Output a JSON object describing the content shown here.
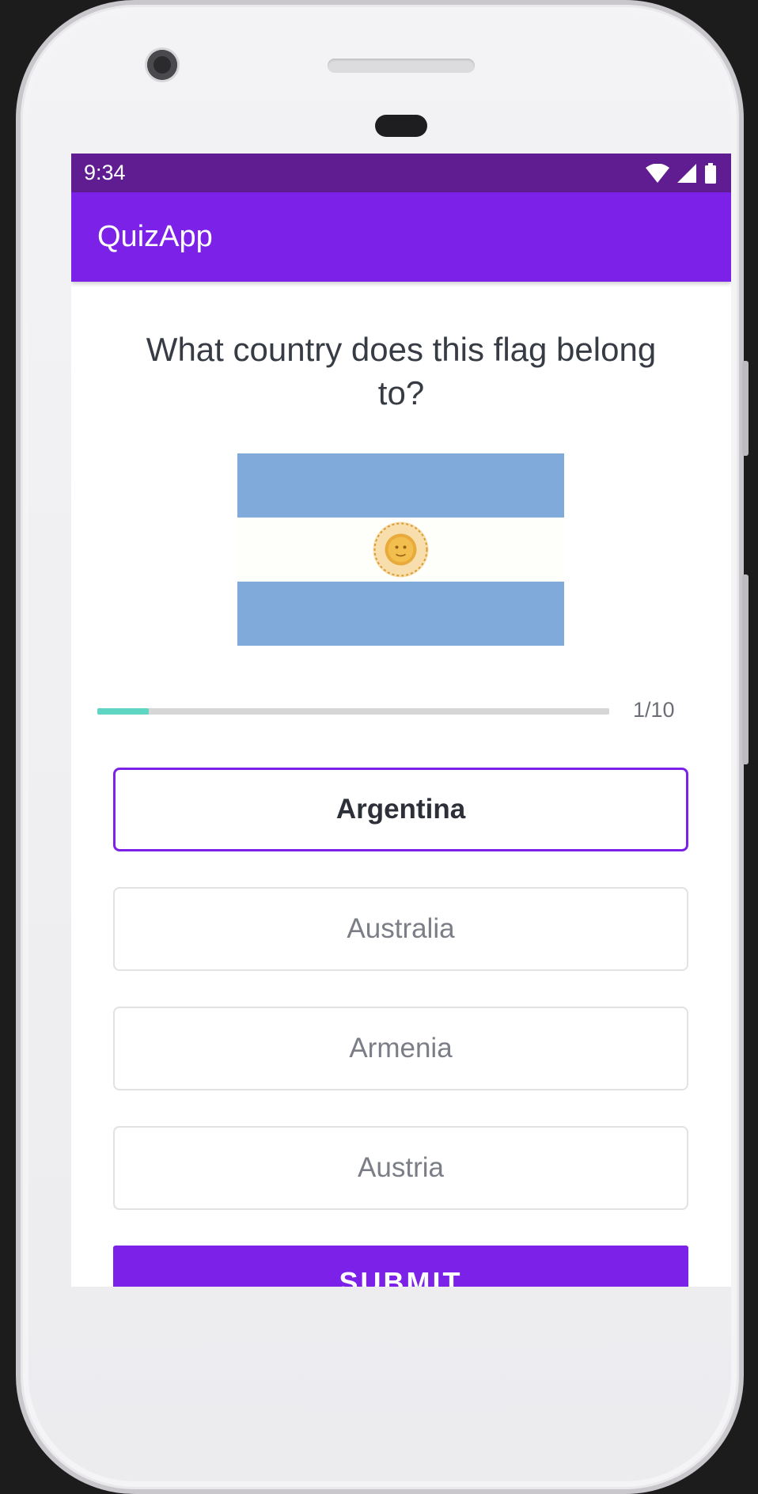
{
  "status_bar": {
    "time": "9:34"
  },
  "app_bar": {
    "title": "QuizApp"
  },
  "question": {
    "text": "What country does this flag belong to?"
  },
  "flag": {
    "icon": "argentina-flag",
    "colors": {
      "stripe": "#80aad9",
      "sun": "#e3a531"
    }
  },
  "progress": {
    "current": 1,
    "total": 10,
    "label": "1/10",
    "fraction": 0.1
  },
  "options": [
    {
      "label": "Argentina",
      "selected": true
    },
    {
      "label": "Australia",
      "selected": false
    },
    {
      "label": "Armenia",
      "selected": false
    },
    {
      "label": "Austria",
      "selected": false
    }
  ],
  "submit": {
    "label": "SUBMIT"
  },
  "colors": {
    "primary": "#7c22e8",
    "primary_dark": "#5f1d91",
    "progress": "#5fd5c4"
  }
}
